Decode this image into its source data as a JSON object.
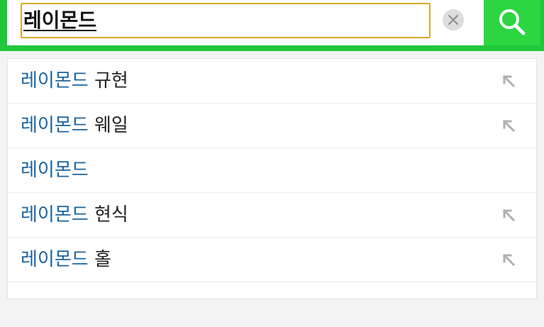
{
  "search": {
    "query": "레이몬드",
    "clear_icon": "close-icon",
    "button_icon": "search-icon",
    "accent_color": "#20c73a",
    "input_border_color": "#d7a928"
  },
  "suggestions": [
    {
      "keyword": "레이몬드",
      "suffix": " 규현",
      "has_arrow": true
    },
    {
      "keyword": "레이몬드",
      "suffix": " 웨일",
      "has_arrow": true
    },
    {
      "keyword": "레이몬드",
      "suffix": "",
      "has_arrow": false
    },
    {
      "keyword": "레이몬드",
      "suffix": " 현식",
      "has_arrow": true
    },
    {
      "keyword": "레이몬드",
      "suffix": " 홀",
      "has_arrow": true
    }
  ],
  "colors": {
    "keyword": "#1a63a0",
    "arrow": "#b0b0b0"
  }
}
